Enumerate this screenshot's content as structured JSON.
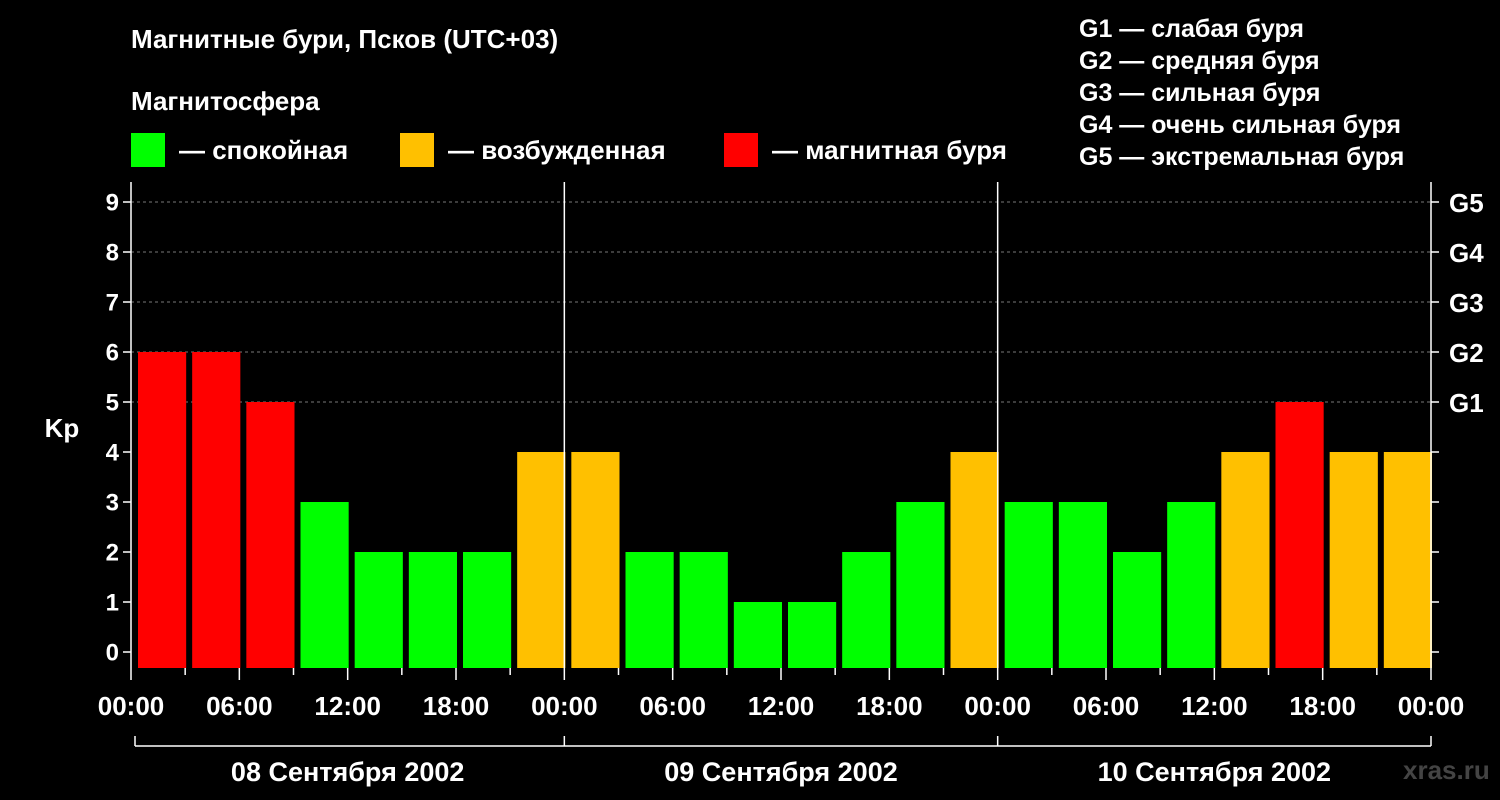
{
  "header": {
    "title": "Магнитные бури, Псков (UTC+03)",
    "subtitle": "Магнитосфера"
  },
  "legend": [
    {
      "label": "— спокойная",
      "color": "#00ff00"
    },
    {
      "label": "— возбужденная",
      "color": "#ffc000"
    },
    {
      "label": "— магнитная буря",
      "color": "#ff0000"
    }
  ],
  "g_scale_legend": [
    "G1 — слабая буря",
    "G2 — средняя буря",
    "G3 — сильная буря",
    "G4 — очень сильная буря",
    "G5 — экстремальная буря"
  ],
  "watermark": "xras.ru",
  "colors": {
    "quiet": "#00ff00",
    "active": "#ffc000",
    "storm": "#ff0000"
  },
  "chart_data": {
    "type": "bar",
    "ylabel": "Kp",
    "ylim": [
      0,
      9
    ],
    "y_ticks": [
      "0",
      "1",
      "2",
      "3",
      "4",
      "5",
      "6",
      "7",
      "8",
      "9"
    ],
    "right_axis_ticks": [
      {
        "value": 5,
        "label": "G1"
      },
      {
        "value": 6,
        "label": "G2"
      },
      {
        "value": 7,
        "label": "G3"
      },
      {
        "value": 8,
        "label": "G4"
      },
      {
        "value": 9,
        "label": "G5"
      }
    ],
    "x_tick_labels": [
      "00:00",
      "06:00",
      "12:00",
      "18:00",
      "00:00",
      "06:00",
      "12:00",
      "18:00",
      "00:00",
      "06:00",
      "12:00",
      "18:00",
      "00:00"
    ],
    "days": [
      "08 Сентября 2002",
      "09 Сентября 2002",
      "10 Сентября 2002"
    ],
    "values": [
      6,
      6,
      5,
      3,
      2,
      2,
      2,
      4,
      4,
      2,
      2,
      1,
      1,
      2,
      3,
      4,
      3,
      3,
      2,
      3,
      4,
      5,
      4,
      4
    ],
    "bar_colors": [
      "#ff0000",
      "#ff0000",
      "#ff0000",
      "#00ff00",
      "#00ff00",
      "#00ff00",
      "#00ff00",
      "#ffc000",
      "#ffc000",
      "#00ff00",
      "#00ff00",
      "#00ff00",
      "#00ff00",
      "#00ff00",
      "#00ff00",
      "#ffc000",
      "#00ff00",
      "#00ff00",
      "#00ff00",
      "#00ff00",
      "#ffc000",
      "#ff0000",
      "#ffc000",
      "#ffc000"
    ],
    "grid": true
  }
}
